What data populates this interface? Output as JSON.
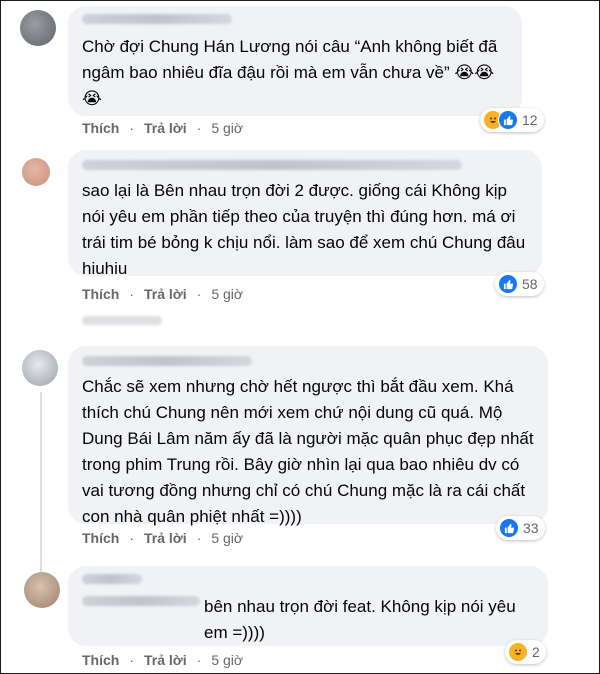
{
  "comments": [
    {
      "text": "Chờ đợi Chung Hán Lương nói câu “Anh không biết đã ngâm bao nhiêu đĩa đậu rồi mà em vẫn chưa về” 😭😭\n😭",
      "like_label": "Thích",
      "reply_label": "Trả lời",
      "time": "5 giờ",
      "reaction_count": "12",
      "reactions": [
        "haha-icon",
        "like-icon"
      ]
    },
    {
      "text": "sao lại là Bên nhau trọn đời 2 được. giống cái Không kịp nói yêu em phần tiếp theo của truyện thì đúng hơn. má ơi trái tim bé bỏng k chịu nổi. làm sao để xem chú Chung đâu hiuhiu",
      "like_label": "Thích",
      "reply_label": "Trả lời",
      "time": "5 giờ",
      "reaction_count": "58",
      "reactions": [
        "like-icon"
      ]
    },
    {
      "text": "Chắc sẽ xem nhưng chờ hết ngược thì bắt đầu xem. Khá thích chú Chung nên mới xem chứ nội dung cũ quá. Mộ Dung Bái Lâm năm ấy đã là người mặc quân phục đẹp nhất trong phim Trung rồi. Bây giờ nhìn lại qua bao nhiêu dv có vai tương đồng nhưng chỉ có chú Chung mặc là ra cái chất con nhà quân phiệt nhất =))))",
      "like_label": "Thích",
      "reply_label": "Trả lời",
      "time": "5 giờ",
      "reaction_count": "33",
      "reactions": [
        "like-icon"
      ]
    },
    {
      "text": "bên nhau trọn đời feat. Không kịp nói yêu em =))))",
      "like_label": "Thích",
      "reply_label": "Trả lời",
      "time": "5 giờ",
      "reaction_count": "2",
      "reactions": [
        "haha-icon"
      ]
    }
  ],
  "colors": {
    "bubble": "#f0f2f5",
    "like_blue": "#1877f2",
    "haha_yellow": "#f7b125",
    "meta_gray": "#65676b"
  }
}
